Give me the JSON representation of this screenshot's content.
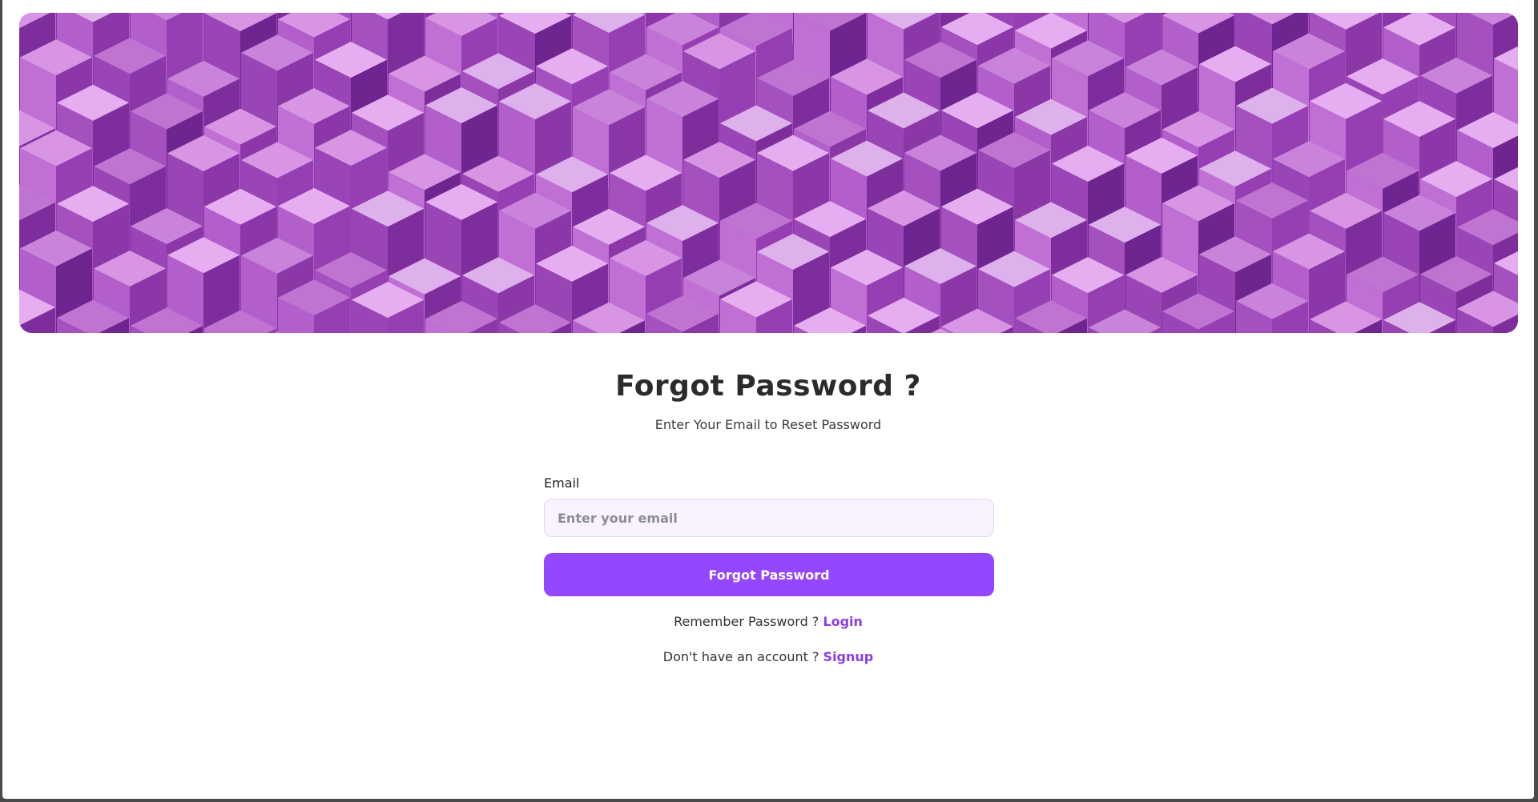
{
  "hero": {
    "alt_description": ""
  },
  "form": {
    "title": "Forgot Password ?",
    "subtitle": "Enter Your Email to Reset Password",
    "email_label": "Email",
    "email_placeholder": "Enter your email",
    "email_value": "",
    "submit_label": "Forgot Password"
  },
  "links": {
    "remember_text": "Remember Password ?",
    "login_label": "Login",
    "no_account_text": "Don't have an account ?",
    "signup_label": "Signup"
  },
  "colors": {
    "accent": "#9547ff",
    "link": "#8a3ee0",
    "input_bg": "#f8f3ff"
  }
}
